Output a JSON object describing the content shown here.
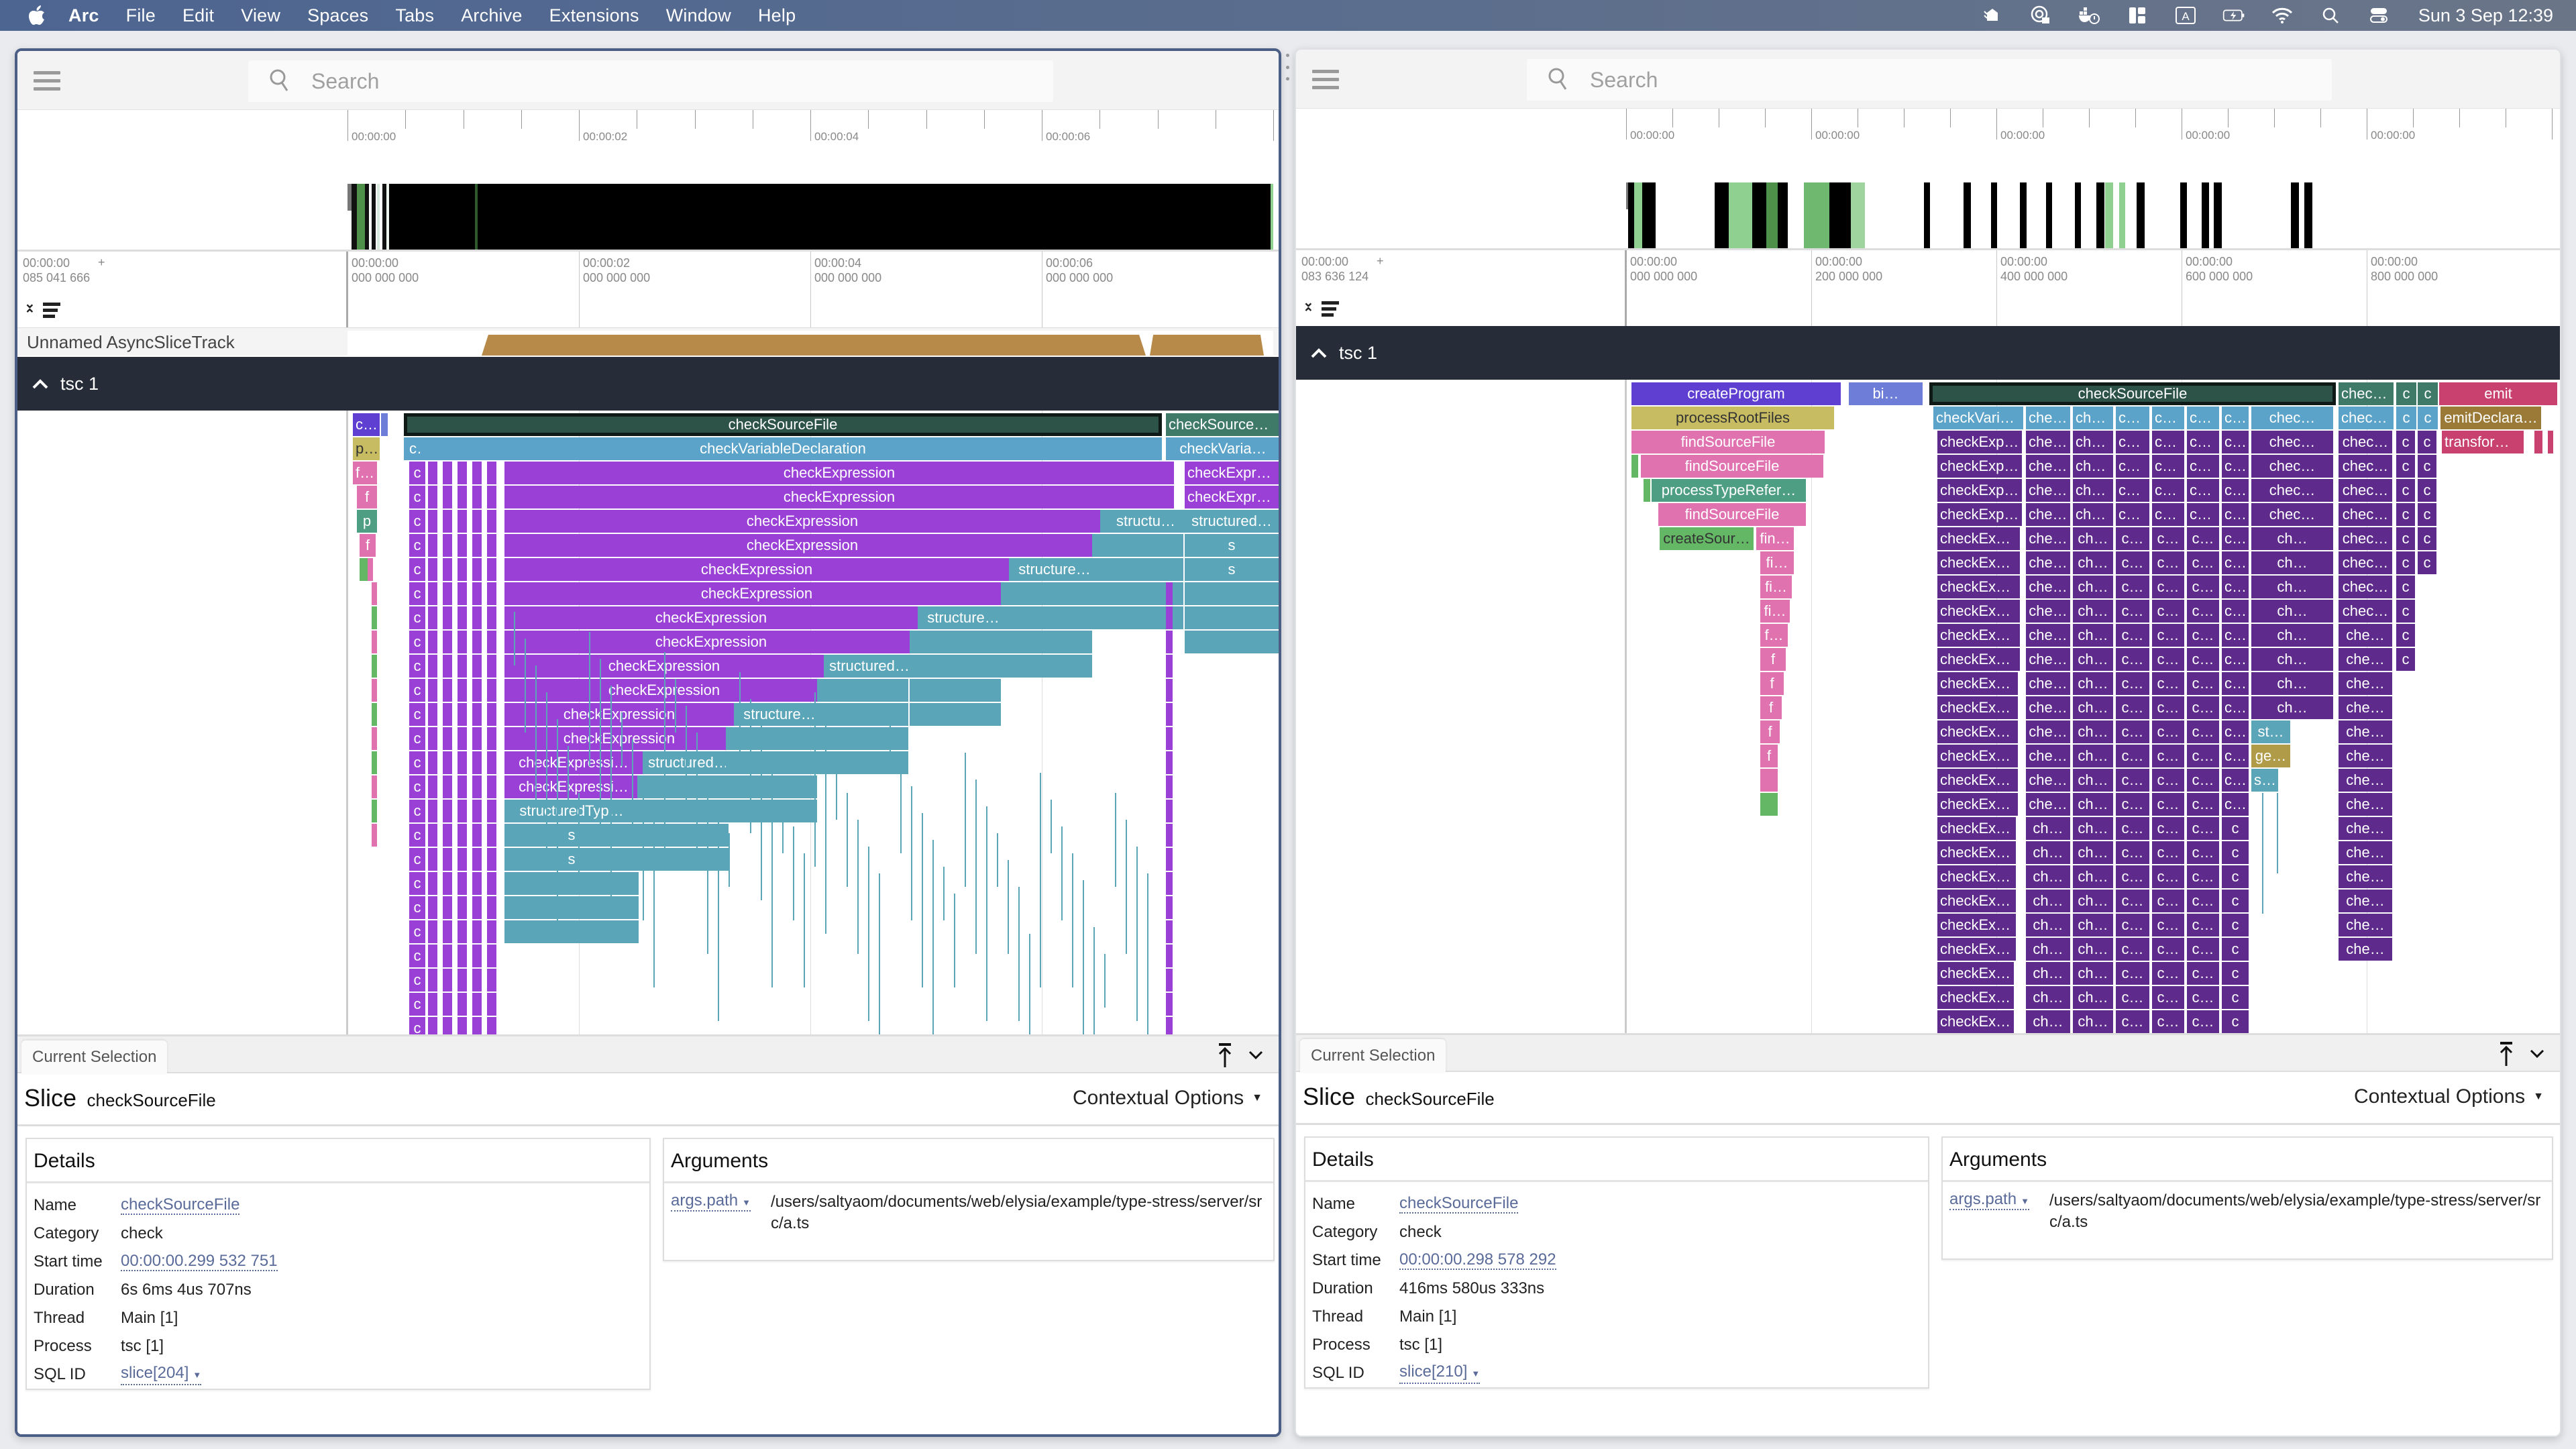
{
  "menubar": {
    "app": "Arc",
    "items": [
      "File",
      "Edit",
      "View",
      "Spaces",
      "Tabs",
      "Archive",
      "Extensions",
      "Window",
      "Help"
    ],
    "status_icons": [
      "dropzone-icon",
      "vpn-lock-icon",
      "docker-alert-icon",
      "split-view-icon",
      "input-source-icon",
      "battery-charging-icon",
      "wifi-icon",
      "spotlight-search-icon",
      "control-center-icon"
    ],
    "input_source": "A",
    "clock": "Sun 3 Sep  12:39"
  },
  "panes": [
    {
      "id": "left",
      "search": {
        "placeholder": "Search",
        "value": ""
      },
      "overview": {
        "tick_labels": [
          "00:00:00",
          "00:00:02",
          "00:00:04",
          "00:00:06"
        ]
      },
      "timeaxis": {
        "offset_line1": "00:00:00",
        "offset_line2": "085 041 666",
        "grid_labels": [
          {
            "l1": "00:00:00",
            "l2": "000 000 000"
          },
          {
            "l1": "00:00:02",
            "l2": "000 000 000"
          },
          {
            "l1": "00:00:04",
            "l2": "000 000 000"
          },
          {
            "l1": "00:00:06",
            "l2": "000 000 000"
          }
        ]
      },
      "async_track_label": "Unnamed AsyncSliceTrack",
      "process_header": "tsc 1",
      "flame_labels": {
        "root_selected": "checkSourceFile",
        "root_right": "checkSourceF…",
        "row1": "checkVariableDeclaration",
        "row1_right": "checkVaria…",
        "check_expression": "checkExpression",
        "check_expression_short": "checkExpressi…",
        "check_expression_right": "checkExpre…",
        "structured": "structured…",
        "structured_short": "structure…",
        "structured_shorter": "structu…",
        "structured_type": "structuredTyp…",
        "s": "s",
        "c": "c",
        "left_col": [
          "c…",
          "p…",
          "f…",
          "f",
          "p",
          "f"
        ]
      },
      "details": {
        "tab": "Current Selection",
        "kind": "Slice",
        "name": "checkSourceFile",
        "contextual_options": "Contextual Options",
        "details_header": "Details",
        "arguments_header": "Arguments",
        "fields": [
          {
            "key": "Name",
            "value": "checkSourceFile",
            "link": true
          },
          {
            "key": "Category",
            "value": "check",
            "link": false
          },
          {
            "key": "Start time",
            "value": "00:00:00.299 532 751",
            "link": true
          },
          {
            "key": "Duration",
            "value": "6s 6ms 4us 707ns",
            "link": false
          },
          {
            "key": "Thread",
            "value": "Main [1]",
            "link": false
          },
          {
            "key": "Process",
            "value": "tsc [1]",
            "link": false
          },
          {
            "key": "SQL ID",
            "value": "slice[204]",
            "link": true,
            "dropdown": true
          }
        ],
        "args": [
          {
            "key": "args.path",
            "value": "/users/saltyaom/documents/web/elysia/example/type-stress/server/src/a.ts"
          }
        ]
      }
    },
    {
      "id": "right",
      "search": {
        "placeholder": "Search",
        "value": ""
      },
      "overview": {
        "tick_labels": [
          "00:00:00",
          "00:00:00",
          "00:00:00",
          "00:00:00",
          "00:00:00"
        ]
      },
      "timeaxis": {
        "offset_line1": "00:00:00",
        "offset_line2": "083 636 124",
        "grid_labels": [
          {
            "l1": "00:00:00",
            "l2": "000 000 000"
          },
          {
            "l1": "00:00:00",
            "l2": "200 000 000"
          },
          {
            "l1": "00:00:00",
            "l2": "400 000 000"
          },
          {
            "l1": "00:00:00",
            "l2": "600 000 000"
          },
          {
            "l1": "00:00:00",
            "l2": "800 000 000"
          }
        ]
      },
      "process_header": "tsc 1",
      "flame_labels": {
        "create_program": "createProgram",
        "bi": "bi…",
        "root_selected": "checkSourceFile",
        "check_right": "check…",
        "c": "c",
        "emit": "emit",
        "process_root_files": "processRootFiles",
        "find_source_file": "findSourceFile",
        "process_type_refer": "processTypeRefer…",
        "create_sour": "createSour…",
        "fin": "fin…",
        "fi": "fi…",
        "f_ell": "f…",
        "f": "f",
        "emit_declara": "emitDeclara…",
        "transform": "transform…",
        "row1_cols": [
          "checkVariab…",
          "chec…",
          "che…",
          "ch…",
          "ch…",
          "ch…",
          "c…",
          "chec…"
        ],
        "expr_cols_top": [
          "checkExpres…",
          "chec…",
          "che…",
          "ch…",
          "ch…",
          "ch…",
          "c…",
          "chec…"
        ],
        "expr_cols_mid": [
          "checkExpre…",
          "che…",
          "ch…",
          "c…",
          "c…",
          "c…",
          "c…",
          "ch…"
        ],
        "expr_cols_low": [
          "checkExpr…",
          "ch…",
          "ch…",
          "c…",
          "c…",
          "c…",
          "c"
        ],
        "st": "st…",
        "ge": "ge…",
        "s_ell": "s…",
        "chec_right": "chec…",
        "che_right": "che…"
      },
      "details": {
        "tab": "Current Selection",
        "kind": "Slice",
        "name": "checkSourceFile",
        "contextual_options": "Contextual Options",
        "details_header": "Details",
        "arguments_header": "Arguments",
        "fields": [
          {
            "key": "Name",
            "value": "checkSourceFile",
            "link": true
          },
          {
            "key": "Category",
            "value": "check",
            "link": false
          },
          {
            "key": "Start time",
            "value": "00:00:00.298 578 292",
            "link": true
          },
          {
            "key": "Duration",
            "value": "416ms 580us 333ns",
            "link": false
          },
          {
            "key": "Thread",
            "value": "Main [1]",
            "link": false
          },
          {
            "key": "Process",
            "value": "tsc [1]",
            "link": false
          },
          {
            "key": "SQL ID",
            "value": "slice[210]",
            "link": true,
            "dropdown": true
          }
        ],
        "args": [
          {
            "key": "args.path",
            "value": "/users/saltyaom/documents/web/elysia/example/type-stress/server/src/a.ts"
          }
        ]
      }
    }
  ],
  "colors": {
    "check_source_file": "#2d5248",
    "check_variable": "#5ba3c9",
    "check_expression_left": "#9a40d6",
    "check_expression_right": "#5e2a8c",
    "structured": "#5ba5b8",
    "create_program": "#5e3fd1",
    "process_root_files": "#c8bc62",
    "find_source_file": "#e072b0",
    "process_type_refer": "#4e9e84",
    "create_source": "#63b765",
    "emit": "#c8416f",
    "emit_declara": "#9a7a36",
    "async_track": "#b88a4a",
    "process_header_bg": "#272d38"
  }
}
